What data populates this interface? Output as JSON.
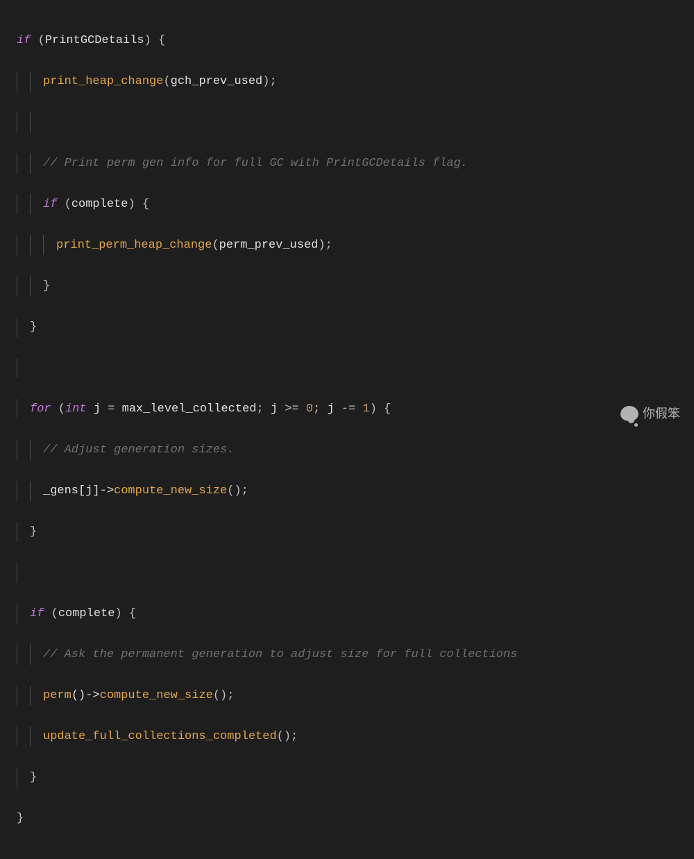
{
  "code": {
    "l1_kw": "if",
    "l1_cond": "PrintGCDetails",
    "l2_fn": "print_heap_change",
    "l2_arg": "gch_prev_used",
    "l4_cmt": "// Print perm gen info for full GC with PrintGCDetails flag.",
    "l5_kw": "if",
    "l5_cond": "complete",
    "l6_fn": "print_perm_heap_change",
    "l6_arg": "perm_prev_used",
    "l10_kw": "for",
    "l10_type": "int",
    "l10_var": "j",
    "l10_eq": "=",
    "l10_init": "max_level_collected",
    "l10_sep1": ";",
    "l10_var2": "j",
    "l10_op1": ">=",
    "l10_num0": "0",
    "l10_sep2": ";",
    "l10_var3": "j",
    "l10_op2": "-=",
    "l10_num1": "1",
    "l11_cmt": "// Adjust generation sizes.",
    "l12_obj": "_gens[j]->",
    "l12_fn": "compute_new_size",
    "l15_kw": "if",
    "l15_cond": "complete",
    "l16_cmt": "// Ask the permanent generation to adjust size for full collections",
    "l17_fn1": "perm",
    "l17_arrow": "()->",
    "l17_fn2": "compute_new_size",
    "l18_fn": "update_full_collections_completed"
  },
  "watermark": "你假笨"
}
